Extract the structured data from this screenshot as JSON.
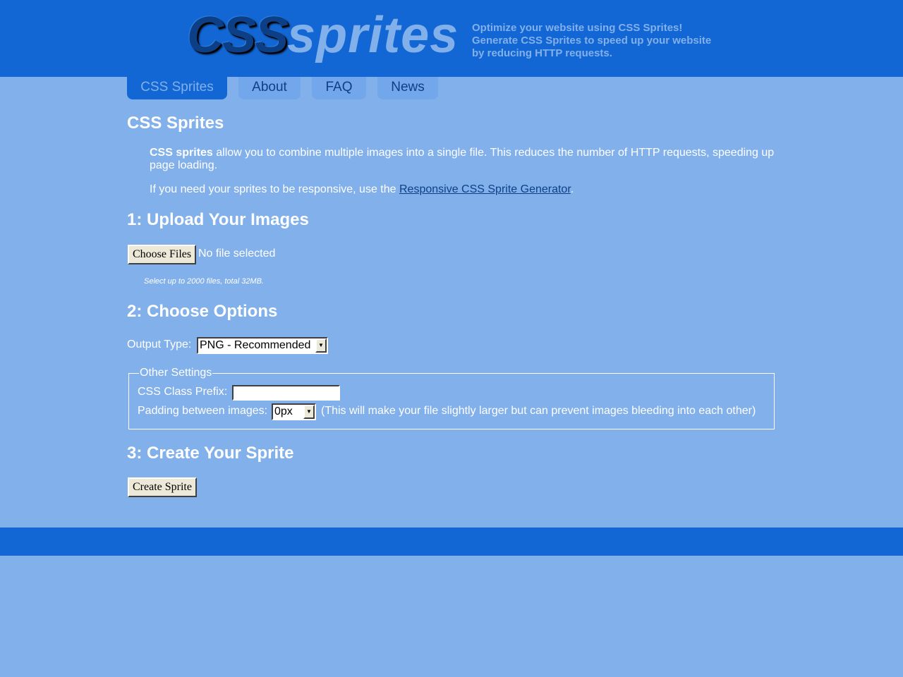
{
  "header": {
    "logo_css": "CSS",
    "logo_sprites": "sprites",
    "tagline": "Optimize your website using CSS Sprites! Generate CSS Sprites to speed up your website by reducing HTTP requests."
  },
  "nav": {
    "tabs": [
      {
        "label": "CSS Sprites",
        "active": true
      },
      {
        "label": "About",
        "active": false
      },
      {
        "label": "FAQ",
        "active": false
      },
      {
        "label": "News",
        "active": false
      }
    ]
  },
  "intro": {
    "heading": "CSS Sprites",
    "p1_bold": "CSS sprites",
    "p1_rest": " allow you to combine multiple images into a single file. This reduces the number of HTTP requests, speeding up page loading.",
    "p2_before": "If you need your sprites to be responsive, use the ",
    "p2_link": "Responsive CSS Sprite Generator",
    "p2_after": "."
  },
  "step1": {
    "heading": "1: Upload Your Images",
    "choose_button": "Choose Files",
    "no_file": "No file selected",
    "hint": "Select up to 2000 files, total 32MB."
  },
  "step2": {
    "heading": "2: Choose Options",
    "output_label": "Output Type:",
    "output_value": "PNG - Recommended",
    "other_settings_legend": "Other Settings",
    "prefix_label": "CSS Class Prefix:",
    "prefix_value": "",
    "padding_label": "Padding between images:",
    "padding_value": "0px",
    "padding_note": "(This will make your file slightly larger but can prevent images bleeding into each other)"
  },
  "step3": {
    "heading": "3: Create Your Sprite",
    "create_button": "Create Sprite"
  },
  "colors": {
    "header_bg": "#1267d4",
    "page_bg": "#82b0ea",
    "link": "#0d3f87"
  }
}
